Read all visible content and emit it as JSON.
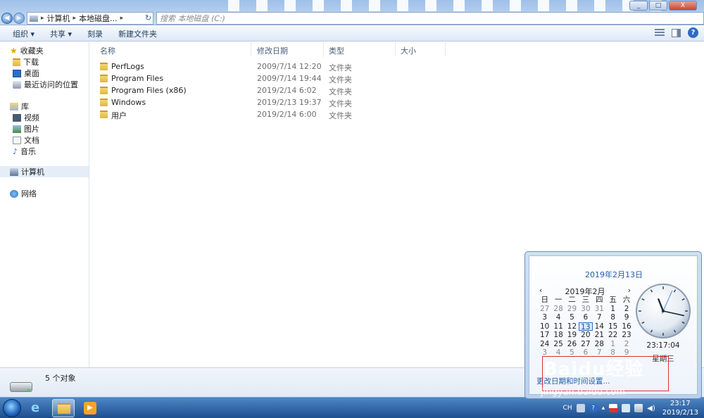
{
  "window": {
    "address": [
      "计算机",
      "本地磁盘..."
    ],
    "search_placeholder": "搜索 本地磁盘 (C:)",
    "buttons": [
      "_",
      "□",
      "X"
    ]
  },
  "toolbar": {
    "organize": "组织 ▾",
    "share": "共享 ▾",
    "burn": "刻录",
    "new_folder": "新建文件夹"
  },
  "navpane": {
    "favorites": "收藏夹",
    "downloads": "下载",
    "desktop": "桌面",
    "recent": "最近访问的位置",
    "libraries": "库",
    "videos": "视频",
    "pictures": "图片",
    "documents": "文档",
    "music": "音乐",
    "computer": "计算机",
    "network": "网络"
  },
  "columns": {
    "name": "名称",
    "date": "修改日期",
    "type": "类型",
    "size": "大小"
  },
  "files": [
    {
      "name": "PerfLogs",
      "date": "2009/7/14 12:20",
      "type": "文件夹"
    },
    {
      "name": "Program Files",
      "date": "2009/7/14 19:44",
      "type": "文件夹"
    },
    {
      "name": "Program Files (x86)",
      "date": "2019/2/14 6:02",
      "type": "文件夹"
    },
    {
      "name": "Windows",
      "date": "2019/2/13 19:37",
      "type": "文件夹"
    },
    {
      "name": "用户",
      "date": "2019/2/14 6:00",
      "type": "文件夹"
    }
  ],
  "status": {
    "count": "5 个对象"
  },
  "flyout": {
    "full_date": "2019年2月13日",
    "month": "2019年2月",
    "weekdays": [
      "日",
      "一",
      "二",
      "三",
      "四",
      "五",
      "六"
    ],
    "weeks": [
      [
        "27",
        "28",
        "29",
        "30",
        "31",
        "1",
        "2"
      ],
      [
        "3",
        "4",
        "5",
        "6",
        "7",
        "8",
        "9"
      ],
      [
        "10",
        "11",
        "12",
        "13",
        "14",
        "15",
        "16"
      ],
      [
        "17",
        "18",
        "19",
        "20",
        "21",
        "22",
        "23"
      ],
      [
        "24",
        "25",
        "26",
        "27",
        "28",
        "1",
        "2"
      ],
      [
        "3",
        "4",
        "5",
        "6",
        "7",
        "8",
        "9"
      ]
    ],
    "today": "13",
    "time": "23:17:04",
    "weekday": "星期三",
    "link": "更改日期和时间设置...",
    "clock_hands": {
      "hour": 23.28,
      "minute": 17.07,
      "second": 4
    }
  },
  "tray": {
    "lang": "CH",
    "time": "23:17",
    "date": "2019/2/13"
  },
  "watermark": {
    "brand": "Baidu经验",
    "url": "jingyan.baidu.com"
  },
  "colors": {
    "accent": "#1f5ea8",
    "taskbar": "#1d4f8f",
    "highlight": "#e5eef8"
  }
}
